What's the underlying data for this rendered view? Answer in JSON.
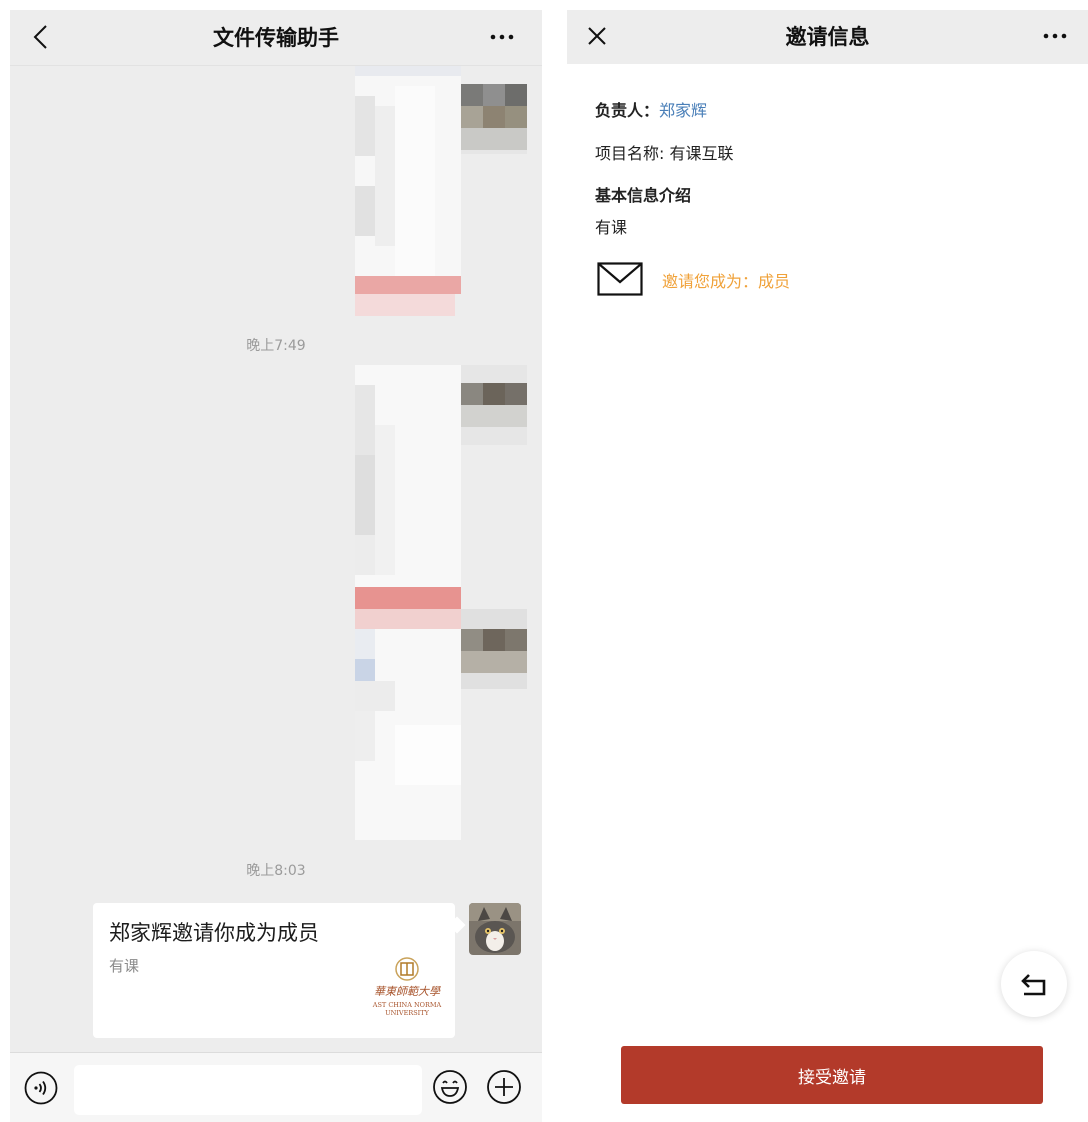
{
  "chat": {
    "title": "文件传输助手",
    "timestamps": [
      "晚上7:49",
      "晚上8:03"
    ],
    "invite_card": {
      "title": "郑家辉邀请你成为成员",
      "subtitle": "有课",
      "logo_text": [
        "華東師範大學",
        "AST CHINA NORMA",
        "UNIVERSITY"
      ]
    },
    "icons": {
      "back": "chevron-left-icon",
      "more": "more-dots-icon",
      "voice": "voice-icon",
      "emoji": "emoji-icon",
      "plus": "plus-icon"
    }
  },
  "invite": {
    "title": "邀请信息",
    "owner_label": "负责人：",
    "owner_name": "郑家辉",
    "project_line": "项目名称: 有课互联",
    "basic_info_heading": "基本信息介绍",
    "basic_info_text": "有课",
    "role_text": "邀请您成为：成员",
    "accept_button": "接受邀请",
    "icons": {
      "close": "close-icon",
      "more": "more-dots-icon",
      "envelope": "envelope-icon",
      "float": "return-arrow-icon"
    },
    "colors": {
      "accept_button": "#b33a2a",
      "role_text": "#f0a23a",
      "owner_link": "#4a7fb8"
    }
  }
}
